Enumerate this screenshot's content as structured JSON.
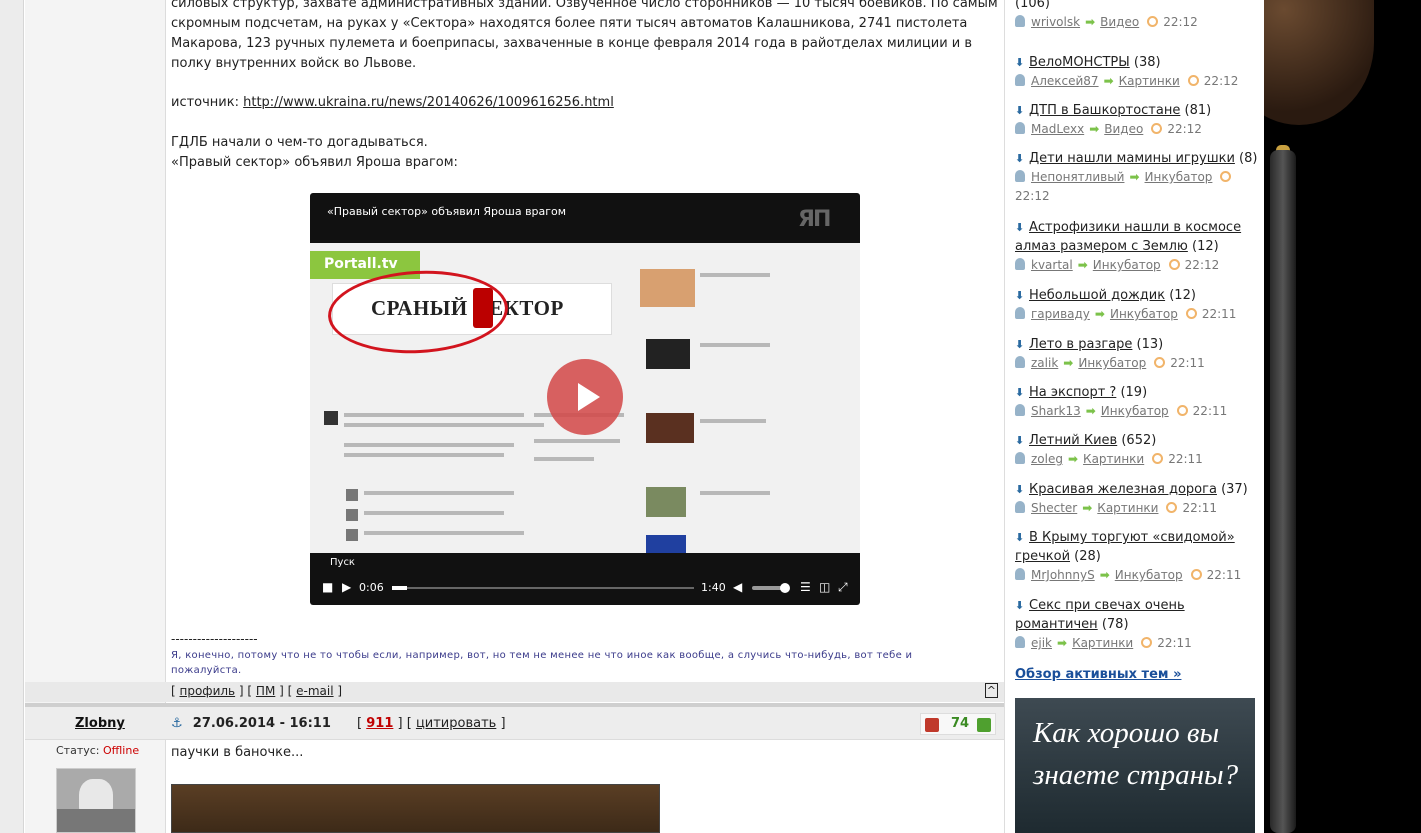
{
  "post1": {
    "text_line1": "силовых структур, захвате административных зданий. Озвученное число сторонников — 10 тысяч боевиков. По самым",
    "text_line2": "скромным подсчетам, на руках у «Сектора» находятся более пяти тысяч автоматов Калашникова, 2741 пистолета",
    "text_line3": "Макарова, 123 ручных пулемета и боеприпасы, захваченные в конце февраля 2014 года в райотделах милиции и в",
    "text_line4": "полку внутренних войск во Львове.",
    "source_label": "источник: ",
    "source_url": "http://www.ukraina.ru/news/20140626/1009616256.html",
    "line_gdlb1": "ГДЛБ начали о чем-то догадываться.",
    "line_gdlb2": "«Правый сектор» объявил Яроша врагом:",
    "video": {
      "title": "«Правый сектор» объявил Яроша врагом",
      "logo": "ЯП",
      "site_label": "Portall.tv",
      "banner_text": "СРАНЫЙ   СЕКТОР",
      "play_label": "Пуск",
      "time_current": "0:06",
      "time_total": "1:40",
      "progress": 0.05
    },
    "sig_line": "--------------------",
    "signature": "Я, конечно, потому что не то чтобы если, например, вот, но тем не менее не что иное как вообще, а случись что-нибудь, вот тебе и пожалуйста.",
    "footer": {
      "profile": "профиль",
      "pm": "ПМ",
      "email": "e-mail",
      "up": "^"
    }
  },
  "post2": {
    "author": "Zlobny",
    "anchor_icon": "anchor-icon",
    "date": "27.06.2014 - 16:11",
    "post_number": "911",
    "quote_label": "цитировать",
    "rating": "74",
    "status_label": "Статус: ",
    "status_value": "Offline",
    "text": "паучки в баночке..."
  },
  "sidebar": {
    "topics": [
      {
        "title": "",
        "count": "(106)",
        "user": "wrivolsk",
        "category": "Видео",
        "time": "22:12"
      },
      {
        "title": "ВелоМОНСТРЫ",
        "count": "(38)",
        "user": "Алексей87",
        "category": "Картинки",
        "time": "22:12"
      },
      {
        "title": "ДТП в Башкортостане",
        "count": "(81)",
        "user": "MadLexx",
        "category": "Видео",
        "time": "22:12"
      },
      {
        "title": "Дети нашли мамины игрушки",
        "count": "(8)",
        "user": "Непонятливый",
        "category": "Инкубатор",
        "time": "22:12"
      },
      {
        "title": "Астрофизики нашли в космосе алмаз размером с Землю",
        "count": "(12)",
        "user": "kvartal",
        "category": "Инкубатор",
        "time": "22:12"
      },
      {
        "title": "Небольшой дождик",
        "count": "(12)",
        "user": "гариваду",
        "category": "Инкубатор",
        "time": "22:11"
      },
      {
        "title": "Лето в разгаре",
        "count": "(13)",
        "user": "zalik",
        "category": "Инкубатор",
        "time": "22:11"
      },
      {
        "title": "На экспорт ?",
        "count": "(19)",
        "user": "Shark13",
        "category": "Инкубатор",
        "time": "22:11"
      },
      {
        "title": "Летний Киев",
        "count": "(652)",
        "user": "zoleg",
        "category": "Картинки",
        "time": "22:11"
      },
      {
        "title": "Красивая железная дорога",
        "count": "(37)",
        "user": "Shecter",
        "category": "Картинки",
        "time": "22:11"
      },
      {
        "title": "В Крыму торгуют «свидомой» гречкой",
        "count": "(28)",
        "user": "MrJohnnyS",
        "category": "Инкубатор",
        "time": "22:11"
      },
      {
        "title": "Секс при свечах очень романтичен",
        "count": "(78)",
        "user": "ejik",
        "category": "Картинки",
        "time": "22:11"
      }
    ],
    "overview_label": "Обзор активных тем »",
    "quiz_text": "Как хорошо вы знаете страны?"
  }
}
